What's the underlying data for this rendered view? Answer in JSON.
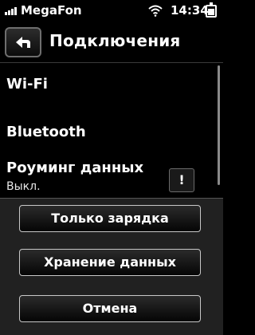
{
  "status_bar": {
    "carrier": "MegaFon",
    "time": "14:34",
    "icons": [
      "signal-icon",
      "wifi-icon",
      "battery-icon"
    ]
  },
  "header": {
    "back_icon": "back-arrow-icon",
    "title": "Подключения"
  },
  "settings": [
    {
      "label": "Wi-Fi"
    },
    {
      "label": "Bluetooth"
    },
    {
      "label": "Роуминг данных",
      "sublabel": "Выкл.",
      "action": "!"
    }
  ],
  "dialog": {
    "buttons": [
      {
        "label": "Только зарядка"
      },
      {
        "label": "Хранение данных"
      },
      {
        "label": "Отмена"
      }
    ]
  }
}
